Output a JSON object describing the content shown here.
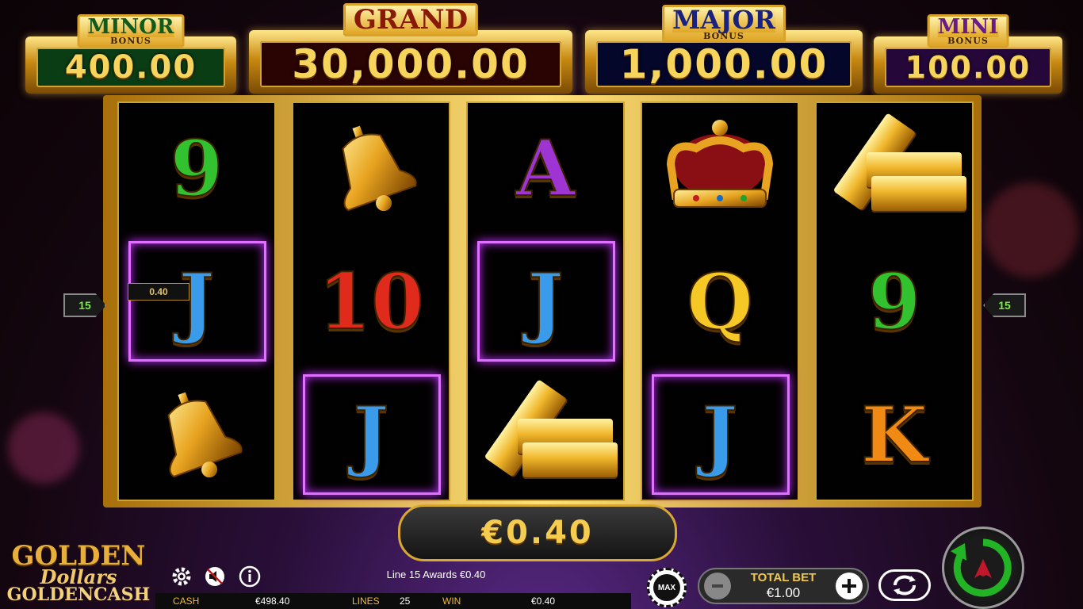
{
  "jackpots": {
    "minor": {
      "name": "MINOR",
      "sub": "BONUS",
      "value": "400.00"
    },
    "grand": {
      "name": "GRAND",
      "value": "30,000.00"
    },
    "major": {
      "name": "MAJOR",
      "sub": "BONUS",
      "value": "1,000.00"
    },
    "mini": {
      "name": "MINI",
      "sub": "BONUS",
      "value": "100.00"
    }
  },
  "reels": [
    [
      "9",
      "J",
      "bell"
    ],
    [
      "bell",
      "10",
      "J"
    ],
    [
      "A",
      "J",
      "gold-bars"
    ],
    [
      "crown",
      "Q",
      "J"
    ],
    [
      "gold-bars",
      "9",
      "K"
    ]
  ],
  "paylines": {
    "left_marker": "15",
    "right_marker": "15",
    "line_win_label": "0.40"
  },
  "win_display": "€0.40",
  "logo": {
    "line1": "GOLDEN",
    "line2": "Dollars",
    "line3": "GOLDENCASH"
  },
  "status_message": "Line 15 Awards €0.40",
  "status_bar": {
    "cash_label": "CASH",
    "cash_value": "€498.40",
    "lines_label": "LINES",
    "lines_value": "25",
    "win_label": "WIN",
    "win_value": "€0.40"
  },
  "bet": {
    "max_label": "MAX",
    "total_bet_label": "TOTAL BET",
    "total_bet_value": "€1.00"
  },
  "colors": {
    "accent_gold": "#f4cd50",
    "win_highlight": "#e070ff",
    "spin_green": "#22b425"
  }
}
